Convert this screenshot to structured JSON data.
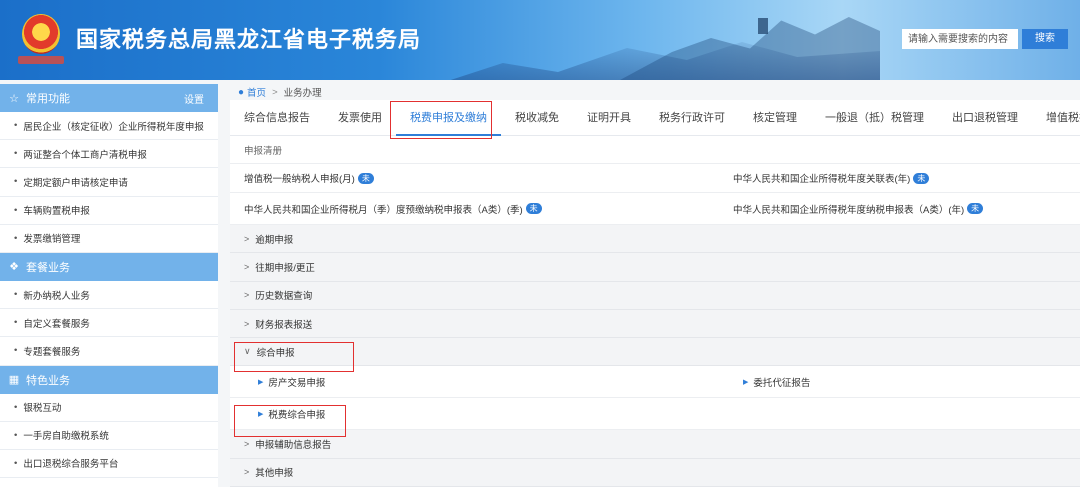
{
  "header": {
    "title": "国家税务总局黑龙江省电子税务局",
    "search_placeholder": "请输入需要搜索的内容",
    "search_button": "搜索"
  },
  "sidebar": {
    "sections": [
      {
        "title": "常用功能",
        "icon": "star-icon",
        "action": "设置",
        "items": [
          "居民企业（核定征收）企业所得税年度申报",
          "两证整合个体工商户清税申报",
          "定期定额户申请核定申请",
          "车辆购置税申报",
          "发票缴销管理"
        ]
      },
      {
        "title": "套餐业务",
        "icon": "layers-icon",
        "items": [
          "新办纳税人业务",
          "自定义套餐服务",
          "专题套餐服务"
        ]
      },
      {
        "title": "特色业务",
        "icon": "grid-icon",
        "items": [
          "银税互动",
          "一手房自助缴税系统",
          "出口退税综合服务平台"
        ]
      }
    ]
  },
  "breadcrumb": {
    "home": "首页",
    "separator": ">",
    "current": "业务办理"
  },
  "tabs": [
    "综合信息报告",
    "发票使用",
    "税费申报及缴纳",
    "税收减免",
    "证明开具",
    "税务行政许可",
    "核定管理",
    "一般退（抵）税管理",
    "出口退税管理",
    "增值税抵扣凭证"
  ],
  "active_tab": "税费申报及缴纳",
  "todo": {
    "label": "申报清册",
    "badge": "未",
    "rows": [
      [
        "增值税一般纳税人申报(月)",
        "中华人民共和国企业所得税年度关联表(年)"
      ],
      [
        "中华人民共和国企业所得税月（季）度预缴纳税申报表（A类）(季)",
        "中华人民共和国企业所得税年度纳税申报表（A类）(年)"
      ]
    ]
  },
  "accordion_top": [
    "逾期申报",
    "往期申报/更正",
    "历史数据查询",
    "财务报表报送"
  ],
  "accordion_open": "综合申报",
  "open_items": [
    "房产交易申报",
    "委托代征报告",
    "税费综合申报"
  ],
  "accordion_bottom": [
    "申报辅助信息报告",
    "其他申报"
  ],
  "colors": {
    "accent": "#2f7ed8",
    "sidebar_header": "#72b2ea",
    "highlight_box": "#e23030"
  }
}
